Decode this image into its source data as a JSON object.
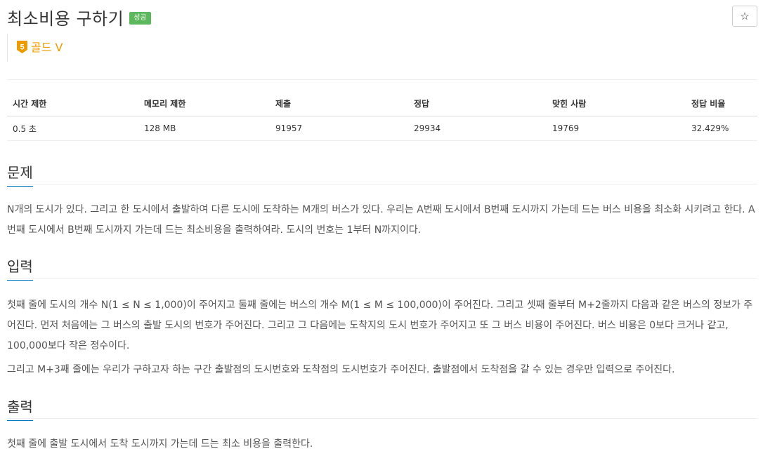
{
  "problem": {
    "title": "최소비용 구하기",
    "result_badge": "성공",
    "star_icon": "☆",
    "tier": {
      "number": "5",
      "label": "골드 V",
      "color": "#ec9a00"
    }
  },
  "info_table": {
    "headers": [
      "시간 제한",
      "메모리 제한",
      "제출",
      "정답",
      "맞힌 사람",
      "정답 비율"
    ],
    "values": [
      "0.5 초",
      "128 MB",
      "91957",
      "29934",
      "19769",
      "32.429%"
    ]
  },
  "sections": {
    "problem": {
      "heading": "문제",
      "text": "N개의 도시가 있다. 그리고 한 도시에서 출발하여 다른 도시에 도착하는 M개의 버스가 있다. 우리는 A번째 도시에서 B번째 도시까지 가는데 드는 버스 비용을 최소화 시키려고 한다. A번째 도시에서 B번째 도시까지 가는데 드는 최소비용을 출력하여라. 도시의 번호는 1부터 N까지이다."
    },
    "input": {
      "heading": "입력",
      "text1": "첫째 줄에 도시의 개수 N(1 ≤ N ≤ 1,000)이 주어지고 둘째 줄에는 버스의 개수 M(1 ≤ M ≤ 100,000)이 주어진다. 그리고 셋째 줄부터 M+2줄까지 다음과 같은 버스의 정보가 주어진다. 먼저 처음에는 그 버스의 출발 도시의 번호가 주어진다. 그리고 그 다음에는 도착지의 도시 번호가 주어지고 또 그 버스 비용이 주어진다. 버스 비용은 0보다 크거나 같고, 100,000보다 작은 정수이다.",
      "text2": "그리고 M+3째 줄에는 우리가 구하고자 하는 구간 출발점의 도시번호와 도착점의 도시번호가 주어진다. 출발점에서 도착점을 갈 수 있는 경우만 입력으로 주어진다."
    },
    "output": {
      "heading": "출력",
      "text": "첫째 줄에 출발 도시에서 도착 도시까지 가는데 드는 최소 비용을 출력한다."
    }
  }
}
